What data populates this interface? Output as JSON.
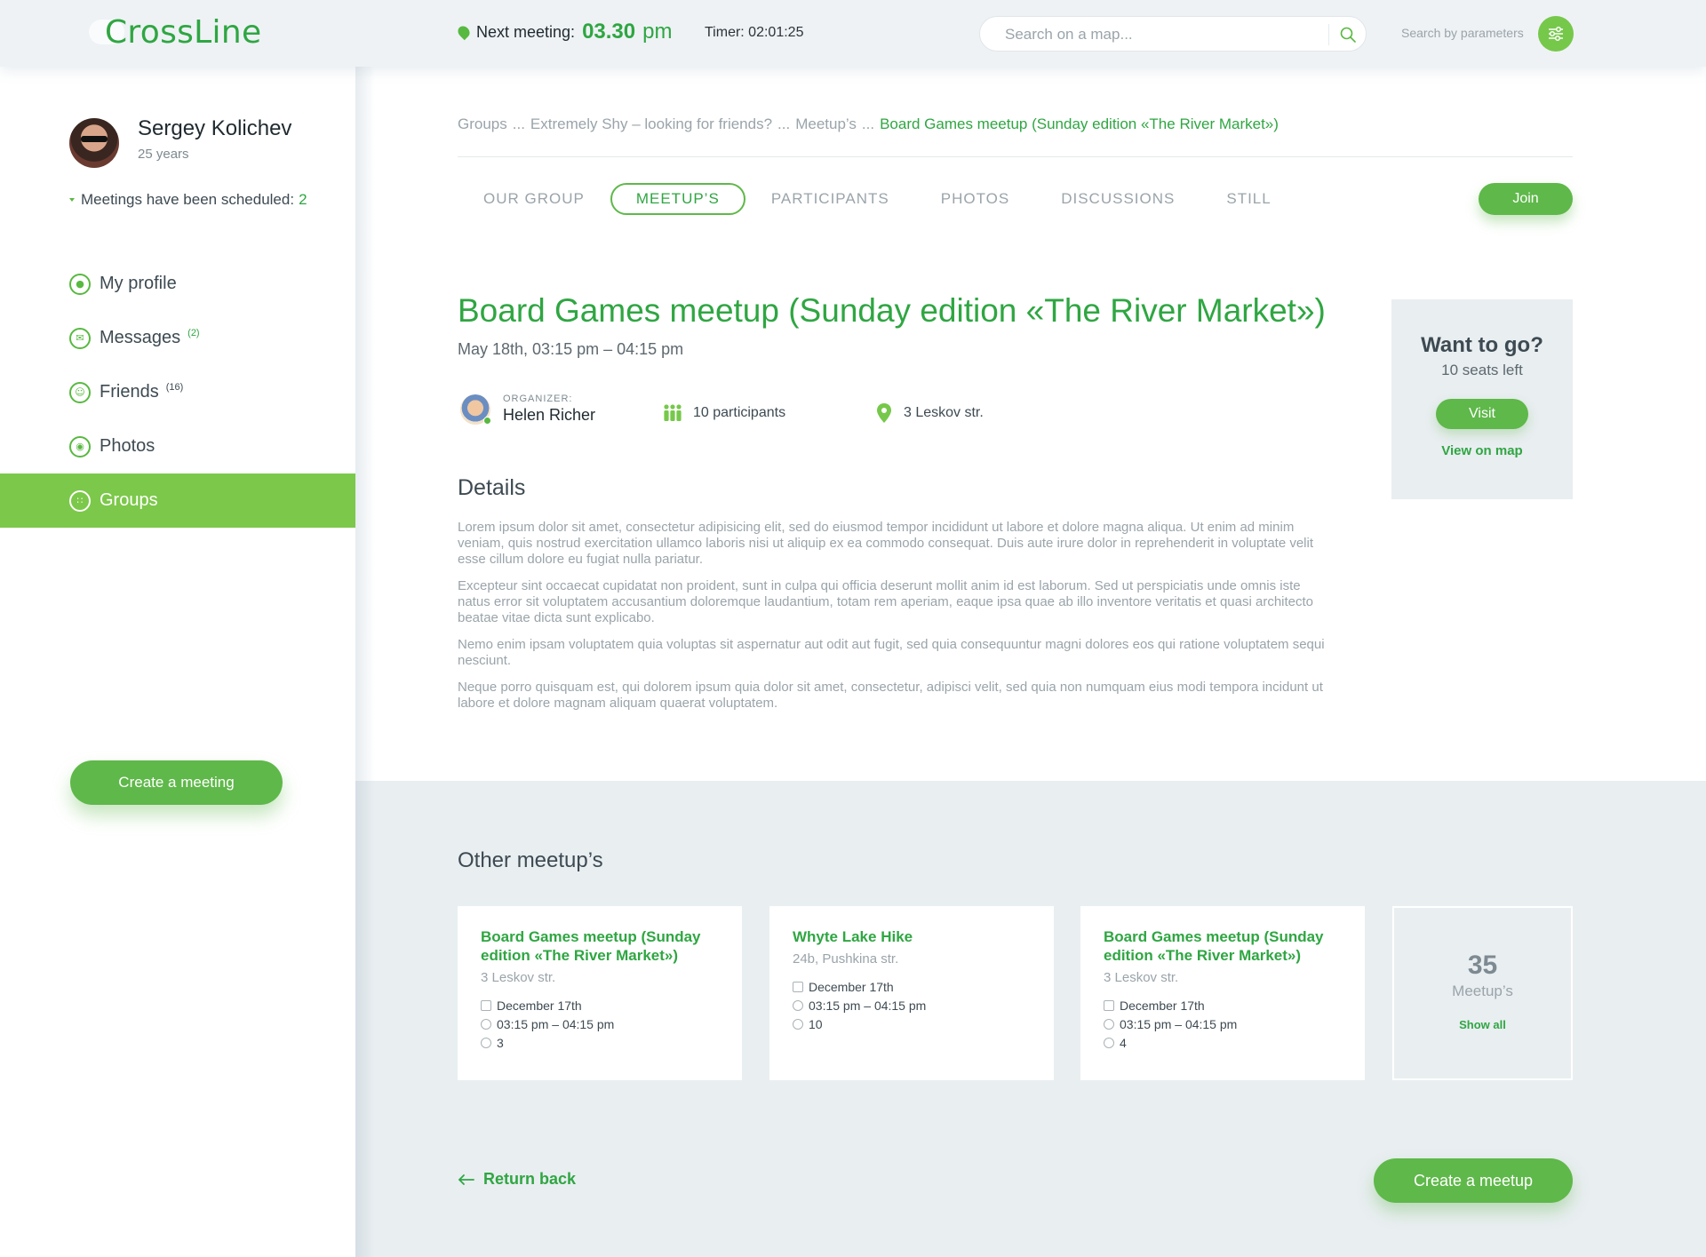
{
  "header": {
    "logo": "CrossLine",
    "next_meeting_label": "Next meeting:",
    "next_meeting_time": "03.30",
    "next_meeting_suffix": "pm",
    "timer": "Timer: 02:01:25",
    "search_placeholder": "Search on a map...",
    "search_params_label": "Search by parameters"
  },
  "user": {
    "name": "Sergey Kolichev",
    "age": "25 years",
    "scheduled_label": "Meetings have been scheduled:",
    "scheduled_count": "2"
  },
  "sidebar": {
    "items": [
      {
        "label": "My profile",
        "icon": "user-icon",
        "badge": ""
      },
      {
        "label": "Messages",
        "icon": "envelope-icon",
        "badge": "(2)"
      },
      {
        "label": "Friends",
        "icon": "smile-icon",
        "badge": "(16)"
      },
      {
        "label": "Photos",
        "icon": "camera-icon",
        "badge": ""
      },
      {
        "label": "Groups",
        "icon": "groups-icon",
        "badge": ""
      }
    ],
    "create_meeting": "Create a meeting"
  },
  "breadcrumb": {
    "c1": "Groups",
    "sep1": "...",
    "c2": "Extremely Shy – looking for friends?",
    "sep2": "...",
    "c3": "Meetup’s",
    "sep3": "...",
    "active": "Board Games meetup (Sunday edition «The River Market»)"
  },
  "tabs": [
    "Our group",
    "Meetup’s",
    "Participants",
    "Photos",
    "Discussions",
    "Still"
  ],
  "join_label": "Join",
  "event": {
    "title": "Board Games meetup (Sunday edition «The River Market»)",
    "date": "May 18th, 03:15 pm – 04:15 pm",
    "organizer_caption": "ORGANIZER:",
    "organizer_name": "Helen Richer",
    "participants": "10 participants",
    "address": "3 Leskov str."
  },
  "details": {
    "title": "Details",
    "paragraphs": [
      "Lorem ipsum dolor sit amet, consectetur adipisicing elit, sed do eiusmod tempor incididunt ut labore et dolore magna aliqua. Ut enim ad minim veniam, quis nostrud exercitation ullamco laboris nisi ut aliquip ex ea commodo consequat. Duis aute irure dolor in reprehenderit in voluptate velit esse cillum dolore eu fugiat nulla pariatur.",
      "Excepteur sint occaecat cupidatat non proident, sunt in culpa qui officia deserunt mollit anim id est laborum. Sed ut perspiciatis unde omnis iste natus error sit voluptatem accusantium doloremque laudantium, totam rem aperiam, eaque ipsa quae ab illo inventore veritatis et quasi architecto beatae vitae dicta sunt explicabo.",
      "Nemo enim ipsam voluptatem quia voluptas sit aspernatur aut odit aut fugit, sed quia consequuntur magni dolores eos qui ratione voluptatem sequi nesciunt.",
      "Neque porro quisquam est, qui dolorem ipsum quia dolor sit amet, consectetur, adipisci velit, sed quia non numquam eius modi tempora incidunt ut labore et dolore magnam aliquam quaerat voluptatem."
    ]
  },
  "want_to_go": {
    "title": "Want to go?",
    "seats": "10 seats left",
    "visit": "Visit",
    "view_map": "View on map"
  },
  "other": {
    "title": "Other  meetup’s",
    "cards": [
      {
        "title": "Board Games meetup (Sunday edition  «The River Market»)",
        "address": "3 Leskov str.",
        "date": "December 17th",
        "time": "03:15 pm – 04:15 pm",
        "people": "3"
      },
      {
        "title": "Whyte Lake Hike",
        "address": "24b, Pushkina str.",
        "date": "December 17th",
        "time": "03:15 pm – 04:15 pm",
        "people": "10"
      },
      {
        "title": "Board Games meetup (Sunday edition  «The River Market»)",
        "address": "3 Leskov str.",
        "date": "December 17th",
        "time": "03:15 pm – 04:15 pm",
        "people": "4"
      }
    ],
    "more_count": "35",
    "more_label": "Meetup’s",
    "show_all": "Show all"
  },
  "footer": {
    "return_back": "Return back",
    "create_meetup": "Create a meetup"
  },
  "colors": {
    "brand_green": "#2fa642",
    "button_green": "#5fb84a",
    "active_nav": "#7cc84a",
    "panel_bg": "#e9eef1"
  }
}
